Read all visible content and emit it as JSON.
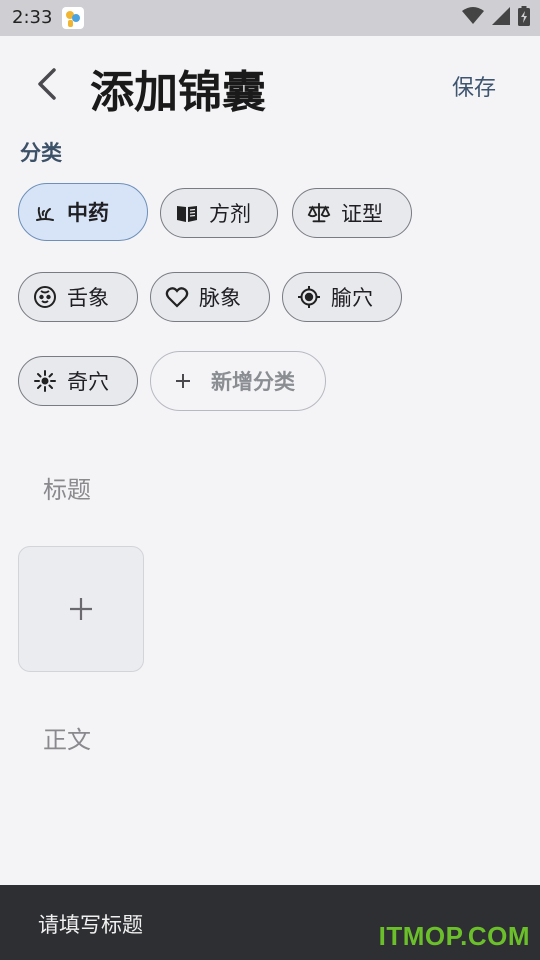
{
  "status_bar": {
    "time": "2:33",
    "icons": [
      "app-notification-icon",
      "wifi-icon",
      "signal-icon",
      "battery-icon"
    ]
  },
  "header": {
    "title": "添加锦囊",
    "save_label": "保存",
    "back_icon": "chevron-left-icon"
  },
  "category": {
    "section_label": "分类",
    "chips": [
      {
        "label": "中药",
        "icon": "herb-icon",
        "selected": true
      },
      {
        "label": "方剂",
        "icon": "book-icon",
        "selected": false
      },
      {
        "label": "证型",
        "icon": "scale-icon",
        "selected": false
      },
      {
        "label": "舌象",
        "icon": "face-icon",
        "selected": false
      },
      {
        "label": "脉象",
        "icon": "heart-icon",
        "selected": false
      },
      {
        "label": "腧穴",
        "icon": "target-icon",
        "selected": false
      },
      {
        "label": "奇穴",
        "icon": "sparkle-icon",
        "selected": false
      }
    ],
    "add_label": "新增分类",
    "add_icon": "plus-icon"
  },
  "form": {
    "title_placeholder": "标题",
    "image_add_icon": "plus-icon",
    "body_placeholder": "正文"
  },
  "snackbar": {
    "message": "请填写标题"
  },
  "watermark": "ITMOP.COM",
  "colors": {
    "background": "#f4f4f7",
    "accent": "#3e5570",
    "selected_chip": "#d7e4f7",
    "snackbar": "#2e2f33",
    "watermark": "#6bbf2a"
  }
}
